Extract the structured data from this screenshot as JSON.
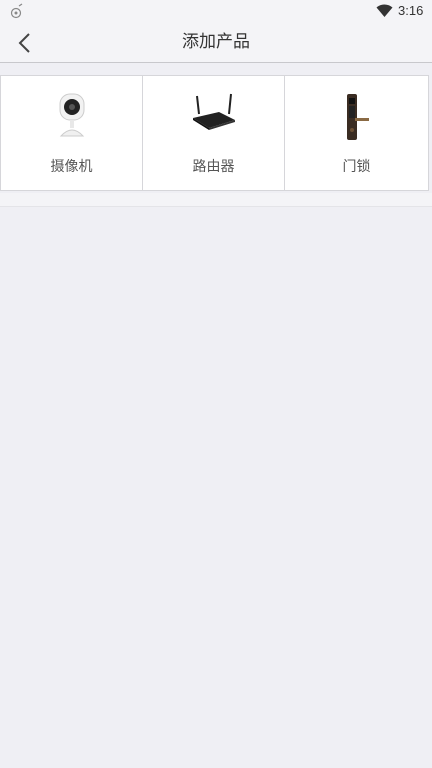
{
  "status_bar": {
    "time": "3:16",
    "left_icon": "notification-icon",
    "wifi_icon": "wifi-icon"
  },
  "header": {
    "title": "添加产品",
    "back_icon": "chevron-left-icon"
  },
  "products": [
    {
      "label": "摄像机",
      "icon": "camera-icon"
    },
    {
      "label": "路由器",
      "icon": "router-icon"
    },
    {
      "label": "门锁",
      "icon": "door-lock-icon"
    }
  ],
  "colors": {
    "background": "#efeff4",
    "bar": "#f4f4f7",
    "tile": "#ffffff",
    "text": "#333333"
  }
}
